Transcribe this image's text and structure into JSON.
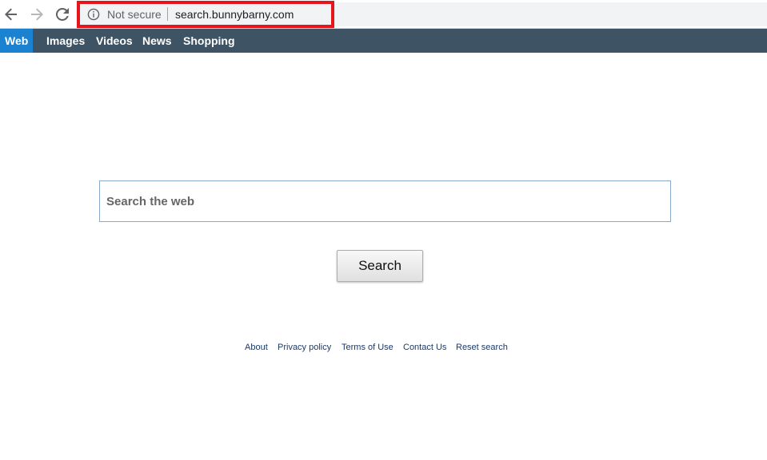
{
  "browser": {
    "security_label": "Not secure",
    "url": "search.bunnybarny.com",
    "icons": {
      "back": "arrow-left-icon",
      "forward": "arrow-right-icon",
      "reload": "reload-icon",
      "info": "info-icon"
    },
    "highlight_color": "#e8141c"
  },
  "site_nav": {
    "items": [
      {
        "label": "Web",
        "active": true
      },
      {
        "label": "Images",
        "active": false
      },
      {
        "label": "Videos",
        "active": false
      },
      {
        "label": "News",
        "active": false
      },
      {
        "label": "Shopping",
        "active": false
      }
    ],
    "bar_color": "#3e5363",
    "active_color": "#1a82d1"
  },
  "search": {
    "placeholder": "Search the web",
    "value": "",
    "button_label": "Search"
  },
  "footer": {
    "links": [
      "About",
      "Privacy policy",
      "Terms of Use",
      "Contact Us",
      "Reset search"
    ]
  }
}
